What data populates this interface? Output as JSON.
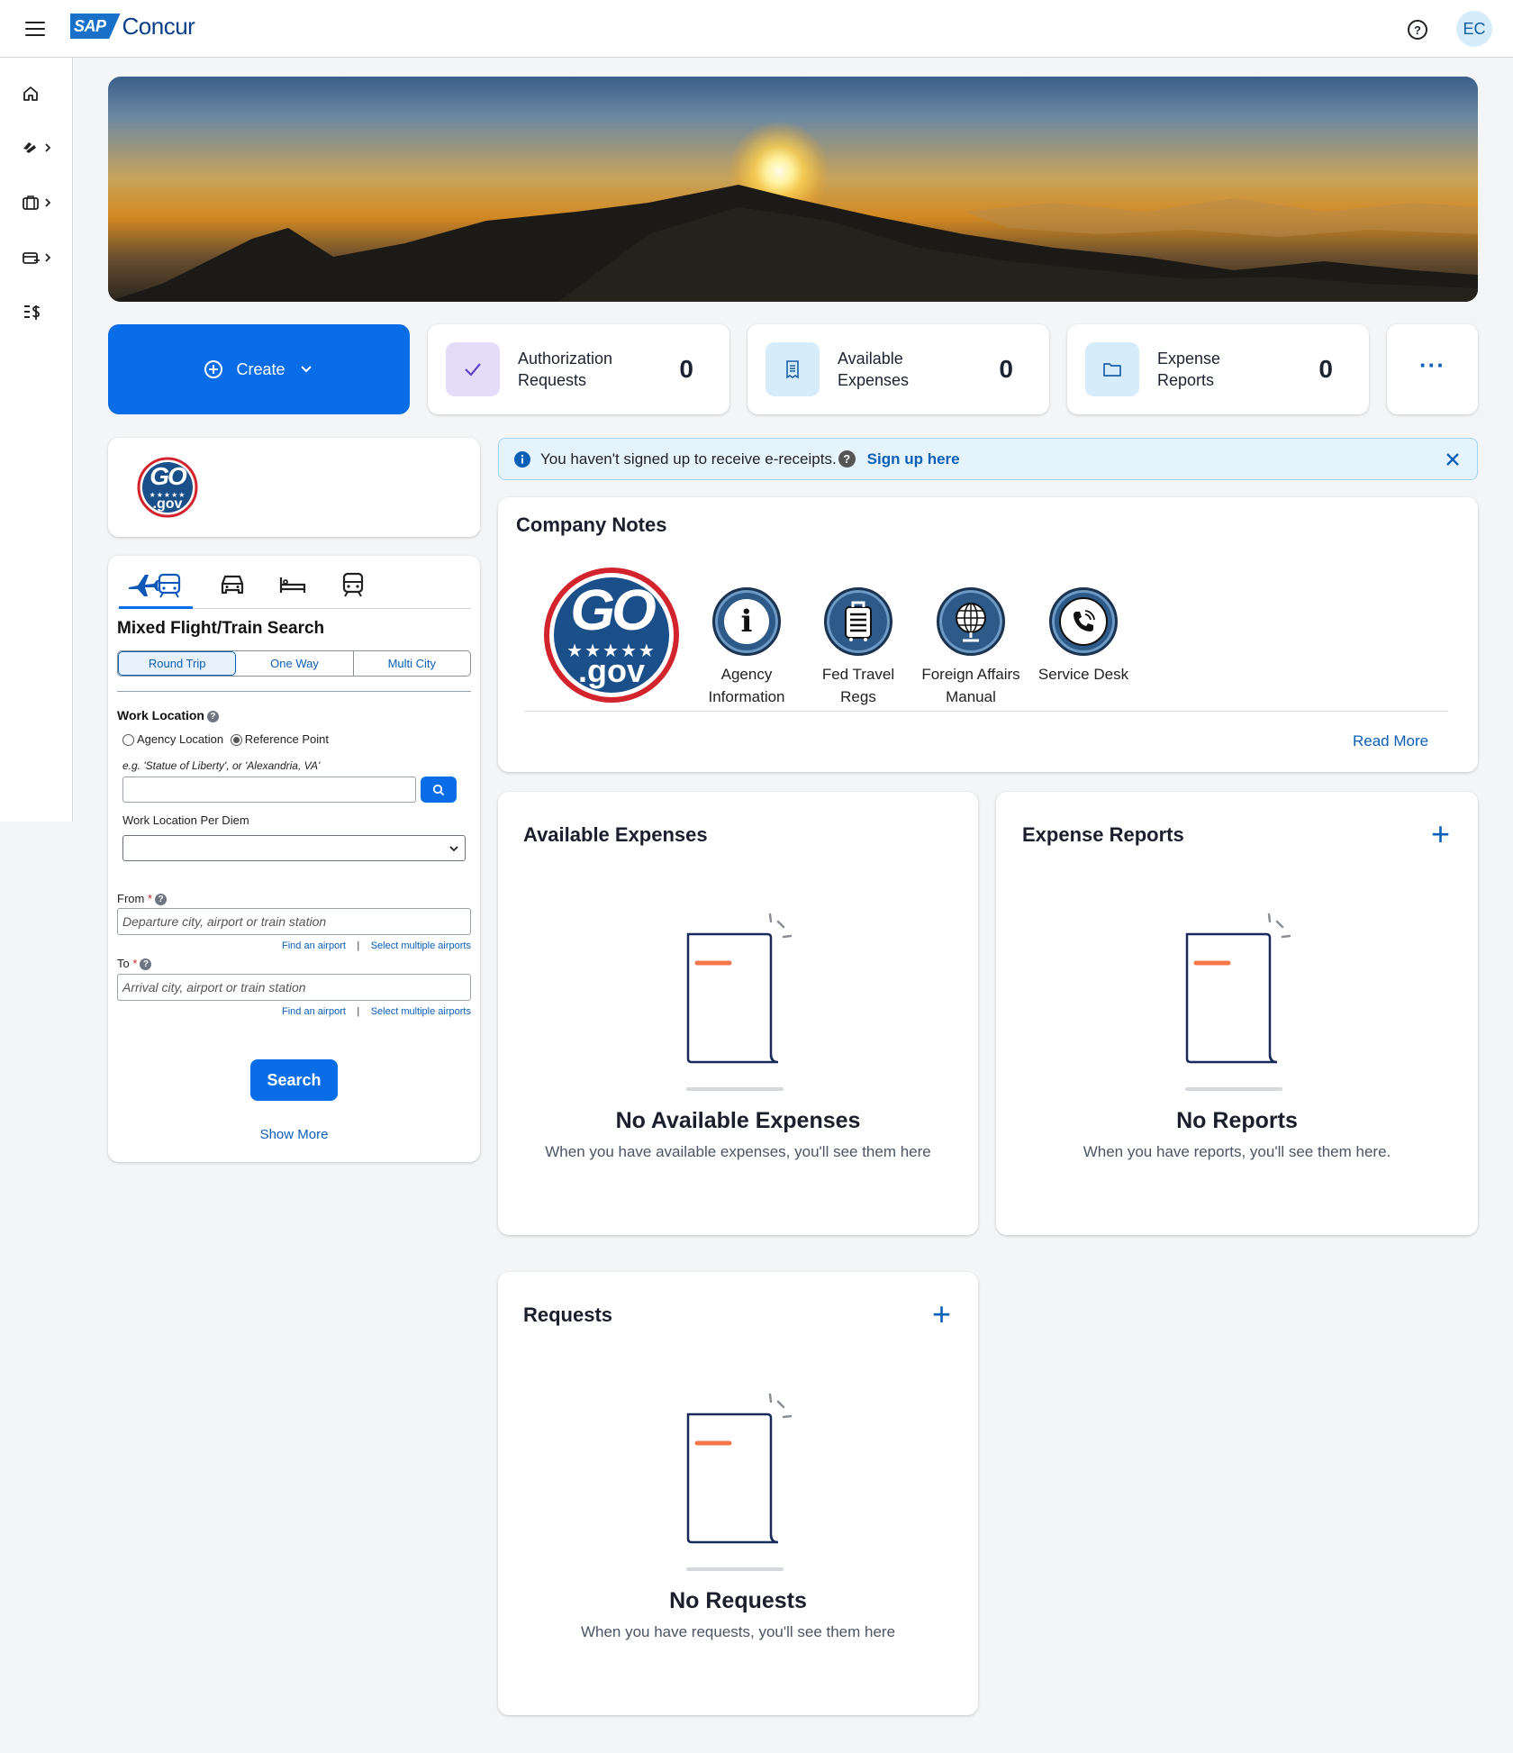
{
  "header": {
    "logo_sap": "SAP",
    "logo_concur": "Concur",
    "help": "?",
    "avatar_initials": "EC"
  },
  "tiles": {
    "create": {
      "label": "Create"
    },
    "authorization": {
      "label_line1": "Authorization",
      "label_line2": "Requests",
      "count": "0"
    },
    "available": {
      "label_line1": "Available",
      "label_line2": "Expenses",
      "count": "0"
    },
    "reports": {
      "label_line1": "Expense",
      "label_line2": "Reports",
      "count": "0"
    },
    "more": "···"
  },
  "logo_card": {
    "go": "GO",
    "gov": ".gov"
  },
  "search": {
    "title": "Mixed Flight/Train Search",
    "trip_types": [
      "Round Trip",
      "One Way",
      "Multi City"
    ],
    "work_location_label": "Work Location",
    "radio_agency": "Agency Location",
    "radio_reference": "Reference Point",
    "example_hint": "e.g. 'Statue of Liberty', or 'Alexandria, VA'",
    "per_diem_label": "Work Location Per Diem",
    "from_label": "From",
    "from_placeholder": "Departure city, airport or train station",
    "to_label": "To",
    "to_placeholder": "Arrival city, airport or train station",
    "required_mark": "*",
    "find_airport": "Find an airport",
    "separator": "|",
    "select_multiple": "Select multiple airports",
    "search_button": "Search",
    "show_more": "Show More"
  },
  "banner": {
    "text": "You haven't signed up to receive e-receipts.",
    "link": "Sign up here"
  },
  "company_notes": {
    "title": "Company Notes",
    "go": "GO",
    "gov": ".gov",
    "items": [
      {
        "line1": "Agency",
        "line2": "Information"
      },
      {
        "line1": "Fed Travel",
        "line2": "Regs"
      },
      {
        "line1": "Foreign Affairs",
        "line2": "Manual"
      },
      {
        "line1": "Service Desk",
        "line2": ""
      }
    ],
    "read_more": "Read More"
  },
  "available_expenses": {
    "title": "Available Expenses",
    "empty_title": "No Available Expenses",
    "empty_sub": "When you have available expenses, you'll see them here"
  },
  "expense_reports": {
    "title": "Expense Reports",
    "empty_title": "No Reports",
    "empty_sub": "When you have reports, you'll see them here."
  },
  "requests": {
    "title": "Requests",
    "empty_title": "No Requests",
    "empty_sub": "When you have requests, you'll see them here"
  },
  "colors": {
    "primary": "#0a6de8",
    "link": "#0a5fb8",
    "empty_accent": "#f4784c",
    "empty_outline": "#1a2a5a"
  }
}
